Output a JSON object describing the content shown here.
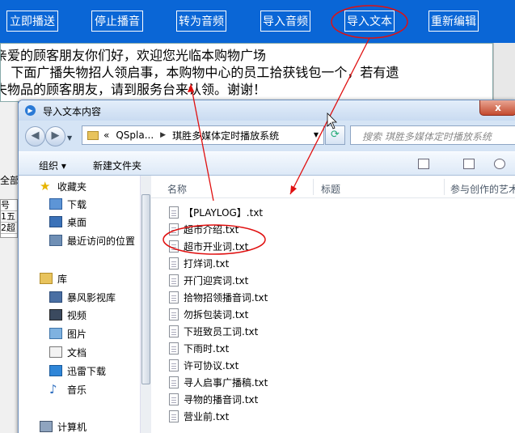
{
  "toolbar": {
    "buttons": [
      {
        "label": "立即播送"
      },
      {
        "label": "停止播音"
      },
      {
        "label": "转为音频"
      },
      {
        "label": "导入音频"
      },
      {
        "label": "导入文本"
      },
      {
        "label": "重新编辑"
      }
    ]
  },
  "editor": {
    "lines": [
      "亲爱的顾客朋友你们好，欢迎您光临本购物广场",
      "    下面广播失物招人领启事，本购物中心的员工拾获钱包一个，若有遗",
      "失物品的顾客朋友，请到服务台来认领。谢谢！"
    ]
  },
  "background_left": {
    "label_all": "全部",
    "col_header": "号",
    "rows": [
      {
        "num": "1",
        "text": "五"
      },
      {
        "num": "2",
        "text": "超"
      }
    ]
  },
  "dialog": {
    "title": "导入文本内容",
    "close": "x",
    "address": {
      "prefix": "«",
      "segments": [
        "QSpla...",
        "琪胜多媒体定时播放系统"
      ]
    },
    "search_placeholder": "搜索 琪胜多媒体定时播放系统",
    "commands": {
      "organize": "组织 ▾",
      "new_folder": "新建文件夹"
    },
    "nav": {
      "favorites": "收藏夹",
      "fav_items": [
        "下载",
        "桌面",
        "最近访问的位置"
      ],
      "libraries": "库",
      "lib_items": [
        "暴风影视库",
        "视频",
        "图片",
        "文档",
        "迅雷下载",
        "音乐"
      ],
      "computer": "计算机"
    },
    "columns": {
      "name": "名称",
      "title": "标题",
      "contributing_artists": "参与创作的艺术家"
    },
    "files": [
      "【PLAYLOG】.txt",
      "超市介绍.txt",
      "超市开业词.txt",
      "打烊词.txt",
      "开门迎宾词.txt",
      "拾物招领播音词.txt",
      "勿拆包装词.txt",
      "下班致员工词.txt",
      "下雨时.txt",
      "许可协议.txt",
      "寻人启事广播稿.txt",
      "寻物的播音词.txt",
      "营业前.txt"
    ]
  },
  "colors": {
    "app_blue": "#0a66d6",
    "annotation_red": "#e01010"
  }
}
